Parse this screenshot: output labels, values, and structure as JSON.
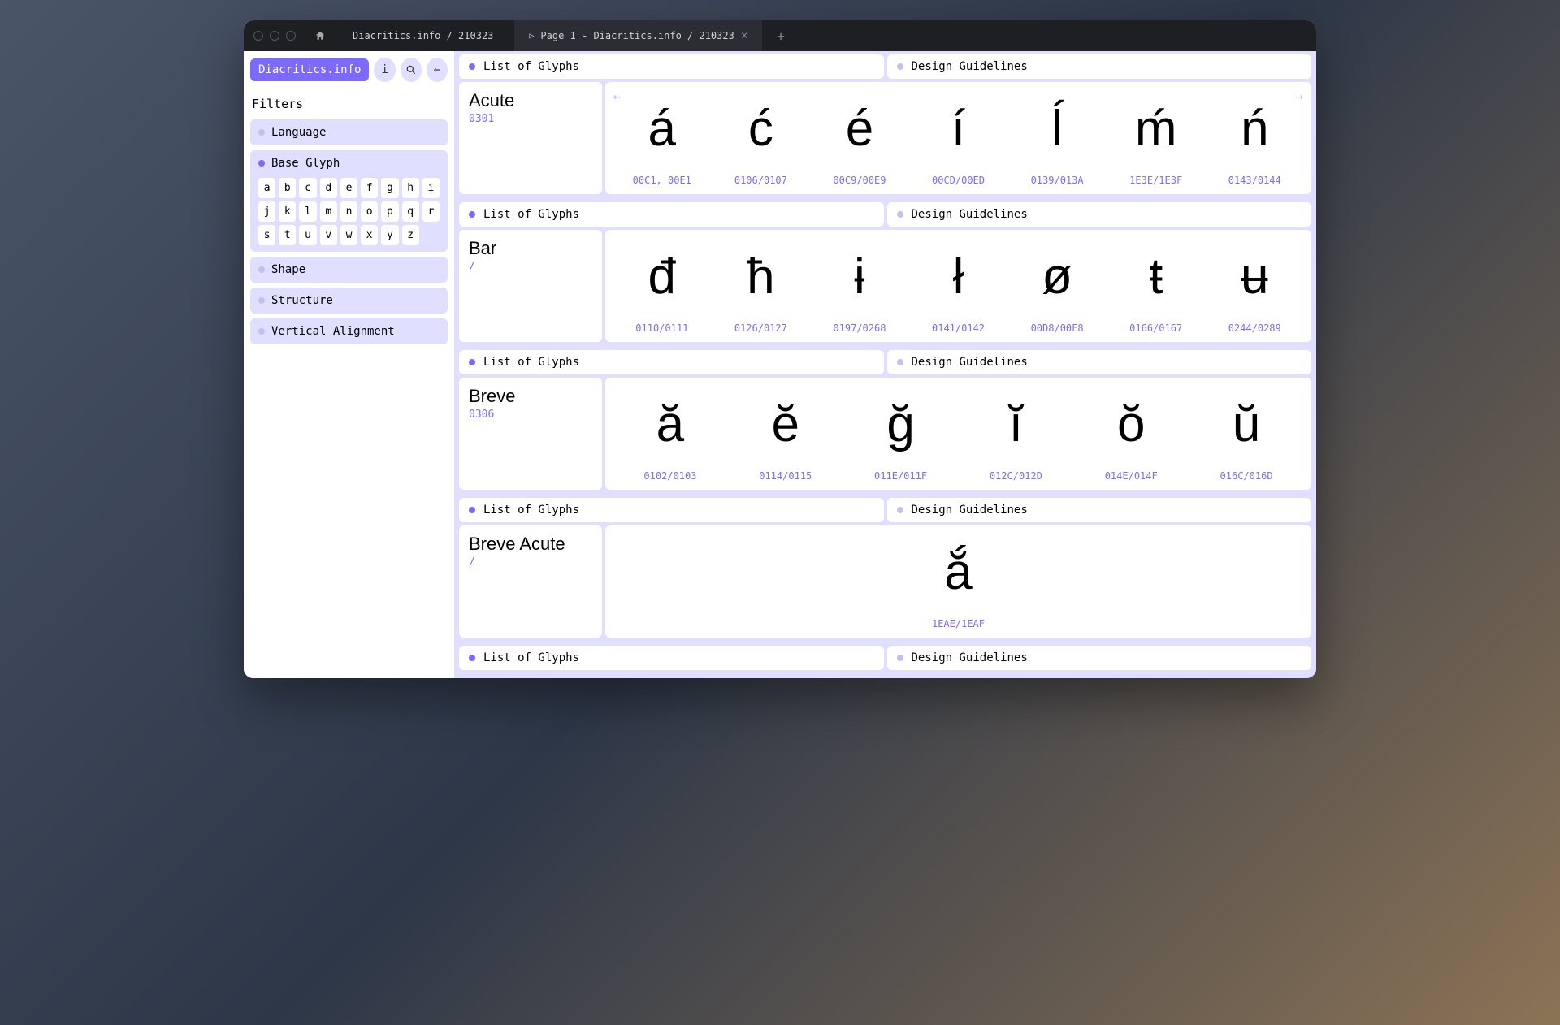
{
  "titlebar": {
    "breadcrumb": "Diacritics.info / 210323",
    "active_tab": "Page 1 - Diacritics.info / 210323"
  },
  "sidebar": {
    "brand": "Diacritics.info",
    "info_label": "i",
    "filters_title": "Filters",
    "filters": {
      "language": "Language",
      "base_glyph": "Base Glyph",
      "shape": "Shape",
      "structure": "Structure",
      "vertical_alignment": "Vertical Alignment"
    },
    "glyphs": [
      "a",
      "b",
      "c",
      "d",
      "e",
      "f",
      "g",
      "h",
      "i",
      "j",
      "k",
      "l",
      "m",
      "n",
      "o",
      "p",
      "q",
      "r",
      "s",
      "t",
      "u",
      "v",
      "w",
      "x",
      "y",
      "z"
    ]
  },
  "tabs": {
    "list": "List of Glyphs",
    "guidelines": "Design Guidelines"
  },
  "sections": [
    {
      "name": "Acute",
      "code": "0301",
      "has_nav": true,
      "glyphs": [
        {
          "char": "á",
          "code": "00C1, 00E1"
        },
        {
          "char": "ć",
          "code": "0106/0107"
        },
        {
          "char": "é",
          "code": "00C9/00E9"
        },
        {
          "char": "í",
          "code": "00CD/00ED"
        },
        {
          "char": "ĺ",
          "code": "0139/013A"
        },
        {
          "char": "ḿ",
          "code": "1E3E/1E3F"
        },
        {
          "char": "ń",
          "code": "0143/0144"
        }
      ]
    },
    {
      "name": "Bar",
      "code": "/",
      "has_nav": false,
      "glyphs": [
        {
          "char": "đ",
          "code": "0110/0111"
        },
        {
          "char": "ħ",
          "code": "0126/0127"
        },
        {
          "char": "ɨ",
          "code": "0197/0268"
        },
        {
          "char": "ł",
          "code": "0141/0142"
        },
        {
          "char": "ø",
          "code": "00D8/00F8"
        },
        {
          "char": "ŧ",
          "code": "0166/0167"
        },
        {
          "char": "ʉ",
          "code": "0244/0289"
        }
      ]
    },
    {
      "name": "Breve",
      "code": "0306",
      "has_nav": false,
      "glyphs": [
        {
          "char": "ă",
          "code": "0102/0103"
        },
        {
          "char": "ĕ",
          "code": "0114/0115"
        },
        {
          "char": "ğ",
          "code": "011E/011F"
        },
        {
          "char": "ĭ",
          "code": "012C/012D"
        },
        {
          "char": "ŏ",
          "code": "014E/014F"
        },
        {
          "char": "ŭ",
          "code": "016C/016D"
        }
      ]
    },
    {
      "name": "Breve Acute",
      "code": "/",
      "has_nav": false,
      "glyphs": [
        {
          "char": "ắ",
          "code": "1EAE/1EAF"
        }
      ]
    },
    {
      "name": "",
      "code": "",
      "tab_only": true
    }
  ]
}
